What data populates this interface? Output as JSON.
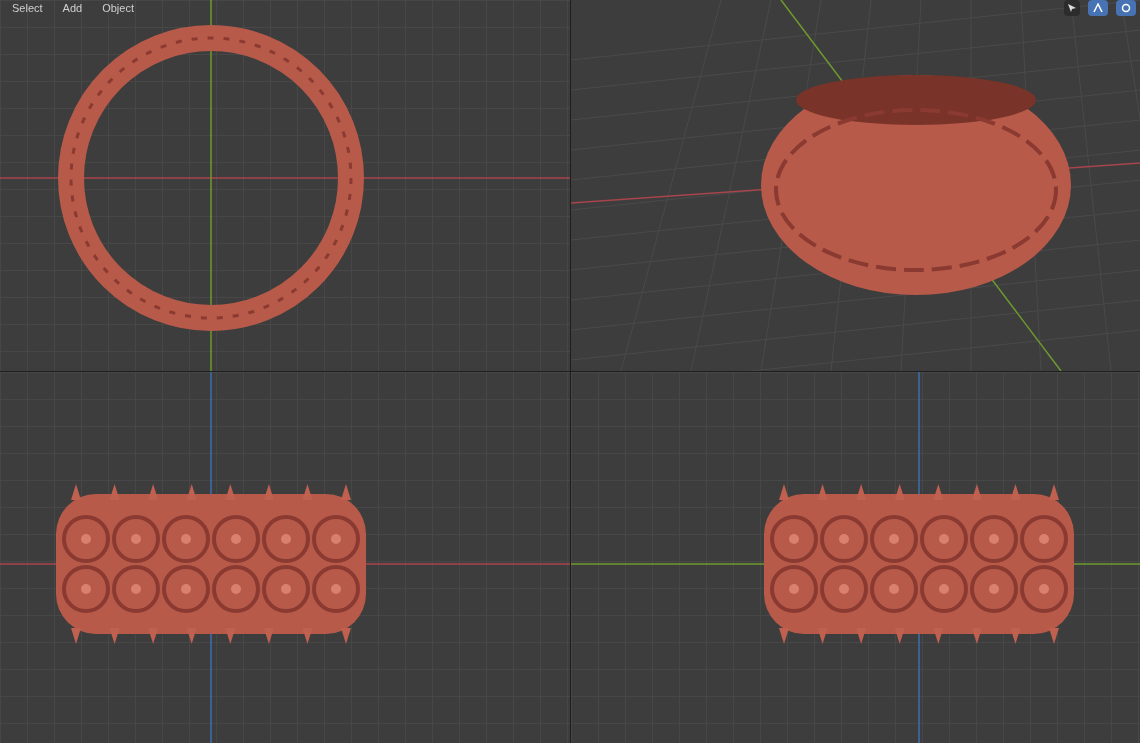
{
  "header_menu": [
    "Select",
    "Add",
    "Object"
  ],
  "viewports": [
    {
      "kind": "top"
    },
    {
      "kind": "perspective"
    },
    {
      "kind": "front"
    },
    {
      "kind": "side"
    }
  ]
}
